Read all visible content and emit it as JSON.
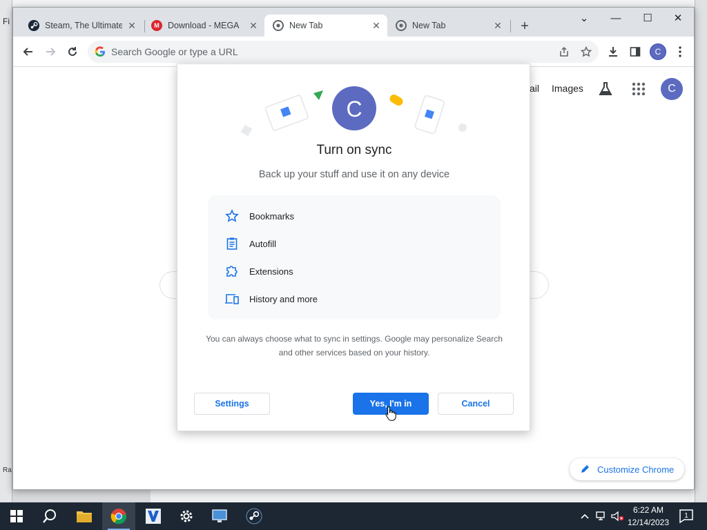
{
  "background_app": {
    "menu_letters": "Fi",
    "status_text": "Ra"
  },
  "browser": {
    "tabs": [
      {
        "title": "Steam, The Ultimate C",
        "favicon": "steam-icon",
        "close": "✕"
      },
      {
        "title": "Download - MEGA",
        "favicon": "mega-icon",
        "close": "✕"
      },
      {
        "title": "New Tab",
        "favicon": "chrome-icon",
        "close": "✕",
        "active": true
      },
      {
        "title": "New Tab",
        "favicon": "chrome-icon",
        "close": "✕"
      }
    ],
    "window_controls": {
      "dropdown": "⌄",
      "minimize": "—",
      "maximize": "☐",
      "close": "✕"
    },
    "omnibox": {
      "placeholder": "Search Google or type a URL",
      "value": ""
    },
    "profile_initial": "C"
  },
  "ntp": {
    "gmail_link": "ail",
    "images_link": "Images",
    "avatar_initial": "C",
    "customize_label": "Customize Chrome"
  },
  "sync_dialog": {
    "avatar_initial": "C",
    "title": "Turn on sync",
    "subtitle": "Back up your stuff and use it on any device",
    "features": [
      {
        "label": "Bookmarks",
        "icon": "star-icon"
      },
      {
        "label": "Autofill",
        "icon": "clipboard-icon"
      },
      {
        "label": "Extensions",
        "icon": "puzzle-icon"
      },
      {
        "label": "History and more",
        "icon": "devices-icon"
      }
    ],
    "note_line1": "You can always choose what to sync in settings. Google may personalize Search",
    "note_line2": "and other services based on your history.",
    "settings_label": "Settings",
    "confirm_label": "Yes, I'm in",
    "cancel_label": "Cancel"
  },
  "taskbar": {
    "clock_time": "6:22 AM",
    "clock_date": "12/14/2023",
    "notification_count": "1"
  },
  "colors": {
    "accent": "#1a73e8",
    "avatar": "#5c6bc0",
    "taskbar": "#1c2733"
  }
}
